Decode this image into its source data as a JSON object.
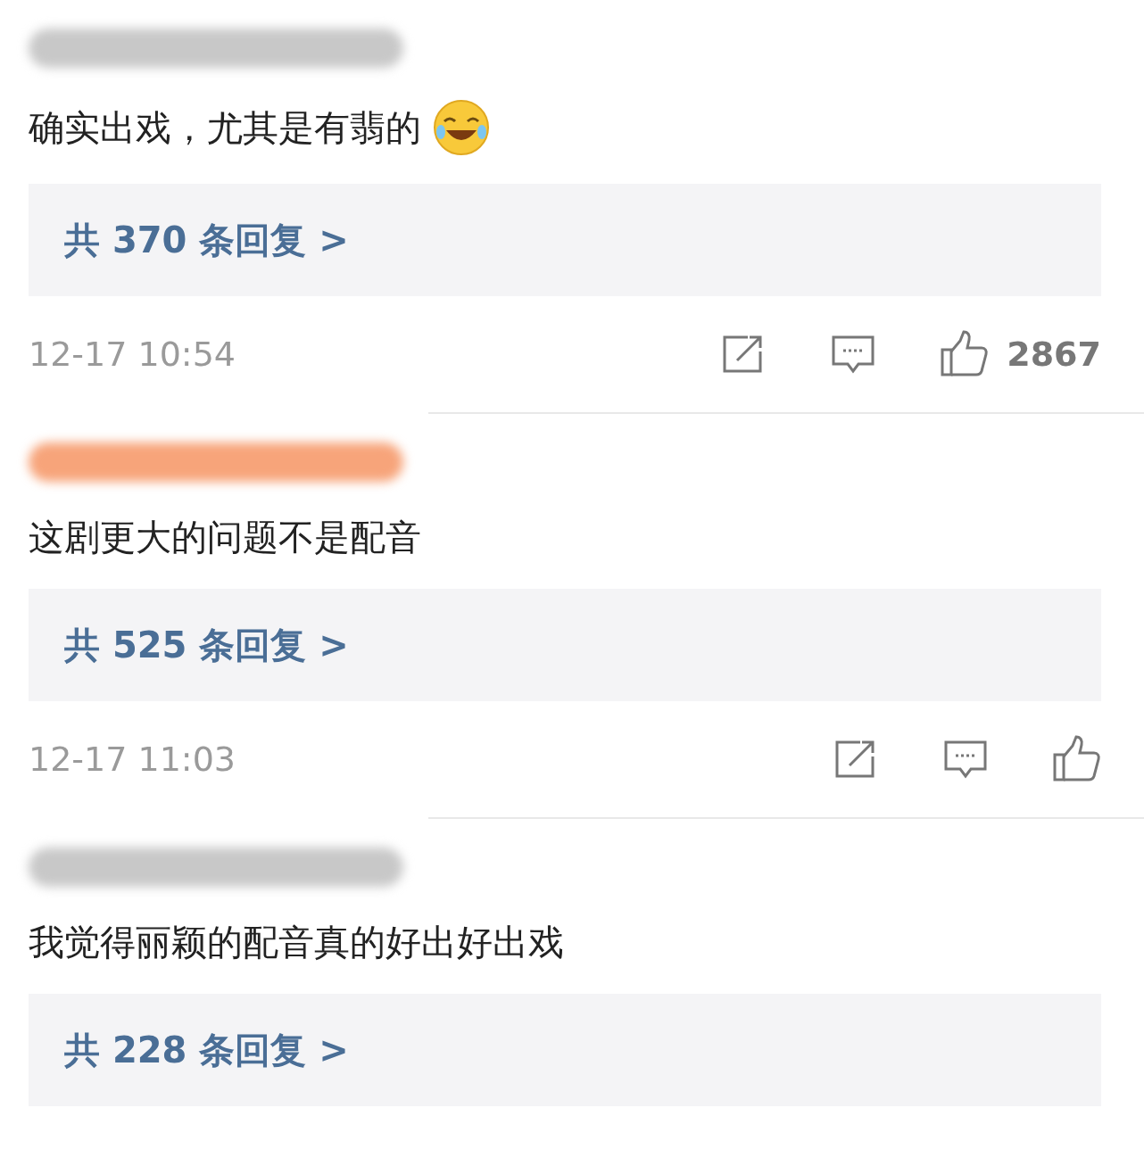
{
  "comments": [
    {
      "color": "#c8c8c8",
      "text": "确实出戏，尤其是有翡的",
      "trailing_emoji": true,
      "replies": "共 370 条回复 >",
      "time": "12-17 10:54",
      "likes": "2867",
      "show_footer": true
    },
    {
      "color": "#f7a47a",
      "text": "这剧更大的问题不是配音",
      "trailing_emoji": false,
      "replies": "共 525 条回复 >",
      "time": "12-17 11:03",
      "show_footer": true
    },
    {
      "color": "#c8c8c8",
      "text": "我觉得丽颖的配音真的好出好出戏",
      "trailing_emoji": false,
      "replies": "共 228 条回复 >",
      "show_footer": false
    }
  ]
}
